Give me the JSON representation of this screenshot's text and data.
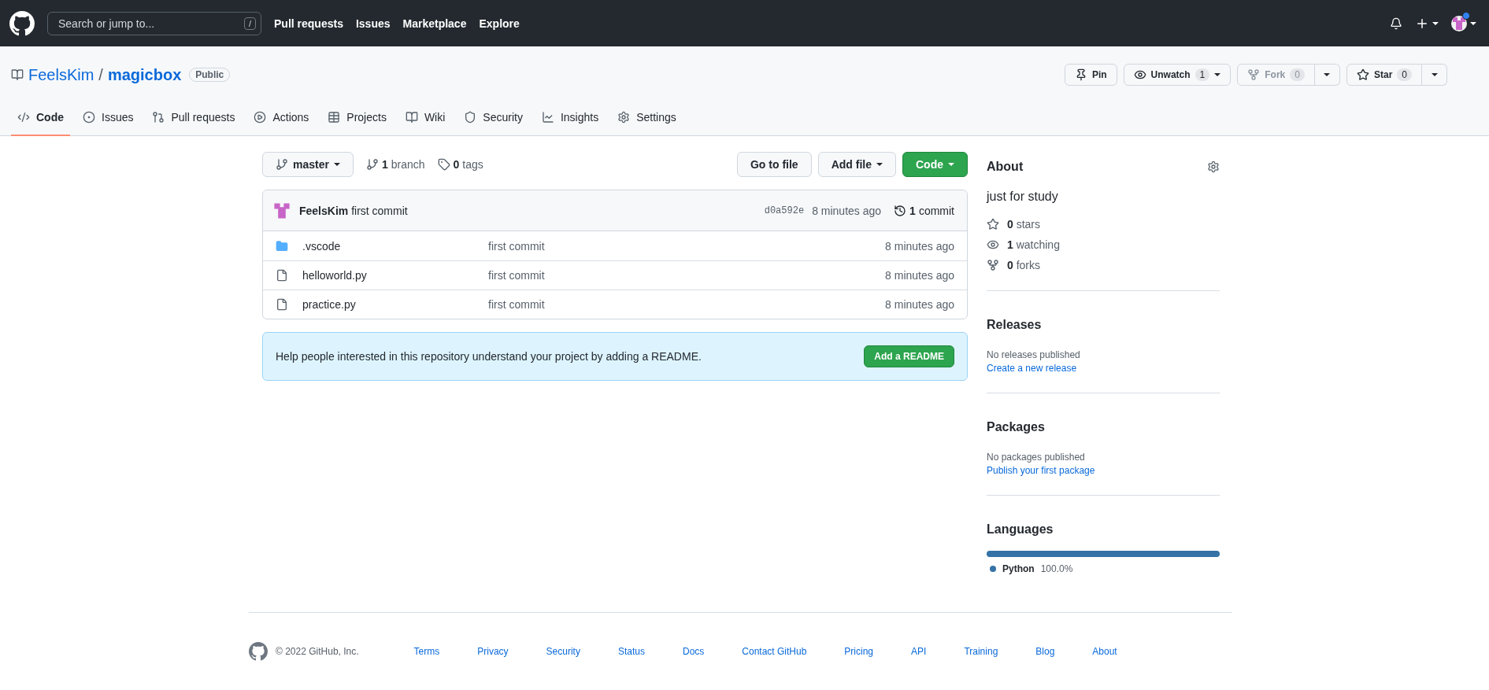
{
  "header": {
    "search": {
      "placeholder": "Search or jump to...",
      "key": "/"
    },
    "nav": [
      "Pull requests",
      "Issues",
      "Marketplace",
      "Explore"
    ],
    "avatar": {
      "badge": true
    }
  },
  "repo": {
    "owner": "FeelsKim",
    "separator": "/",
    "name": "magicbox",
    "visibility": "Public"
  },
  "repo_actions": [
    {
      "kind": "pin",
      "label": "Pin",
      "disabled": false
    },
    {
      "kind": "watch",
      "label": "Unwatch",
      "count": "1",
      "disabled": false
    },
    {
      "kind": "fork",
      "label": "Fork",
      "count": "0",
      "disabled": true
    },
    {
      "kind": "star",
      "label": "Star",
      "count": "0",
      "disabled": false
    }
  ],
  "tabs": [
    {
      "label": "Code",
      "selected": true
    },
    {
      "label": "Issues",
      "selected": false
    },
    {
      "label": "Pull requests",
      "selected": false
    },
    {
      "label": "Actions",
      "selected": false
    },
    {
      "label": "Projects",
      "selected": false
    },
    {
      "label": "Wiki",
      "selected": false
    },
    {
      "label": "Security",
      "selected": false
    },
    {
      "label": "Insights",
      "selected": false
    },
    {
      "label": "Settings",
      "selected": false
    }
  ],
  "toolbar": {
    "branch": "master",
    "branches": {
      "count": "1",
      "label": "branch"
    },
    "tags": {
      "count": "0",
      "label": "tags"
    },
    "buttons": [
      {
        "kind": "default",
        "label": "Go to file",
        "caret": false
      },
      {
        "kind": "default",
        "label": "Add file",
        "caret": true
      },
      {
        "kind": "primary",
        "label": "Code",
        "caret": true
      }
    ]
  },
  "commit": {
    "author": "FeelsKim",
    "message": "first commit",
    "sha": "d0a592e",
    "time": "8 minutes ago",
    "count": "1",
    "count_label": "commit"
  },
  "files": [
    {
      "kind": "folder",
      "name": ".vscode",
      "message": "first commit",
      "time": "8 minutes ago"
    },
    {
      "kind": "file",
      "name": "helloworld.py",
      "message": "first commit",
      "time": "8 minutes ago"
    },
    {
      "kind": "file",
      "name": "practice.py",
      "message": "first commit",
      "time": "8 minutes ago"
    }
  ],
  "readme_prompt": {
    "text": "Help people interested in this repository understand your project by adding a README.",
    "button": "Add a README"
  },
  "about": {
    "title": "About",
    "description": "just for study",
    "stats": [
      {
        "kind": "star",
        "count": "0",
        "label": "stars"
      },
      {
        "kind": "watch",
        "count": "1",
        "label": "watching"
      },
      {
        "kind": "fork",
        "count": "0",
        "label": "forks"
      }
    ]
  },
  "sections": [
    {
      "title": "Releases",
      "empty": "No releases published",
      "link": "Create a new release"
    },
    {
      "title": "Packages",
      "empty": "No packages published",
      "link": "Publish your first package"
    }
  ],
  "languages": {
    "title": "Languages",
    "items": [
      {
        "name": "Python",
        "percent": "100.0%",
        "color": "#3572a5",
        "level": 1
      }
    ]
  },
  "footer": {
    "copyright": "© 2022 GitHub, Inc.",
    "links": [
      "Terms",
      "Privacy",
      "Security",
      "Status",
      "Docs",
      "Contact GitHub",
      "Pricing",
      "API",
      "Training",
      "Blog",
      "About"
    ]
  }
}
